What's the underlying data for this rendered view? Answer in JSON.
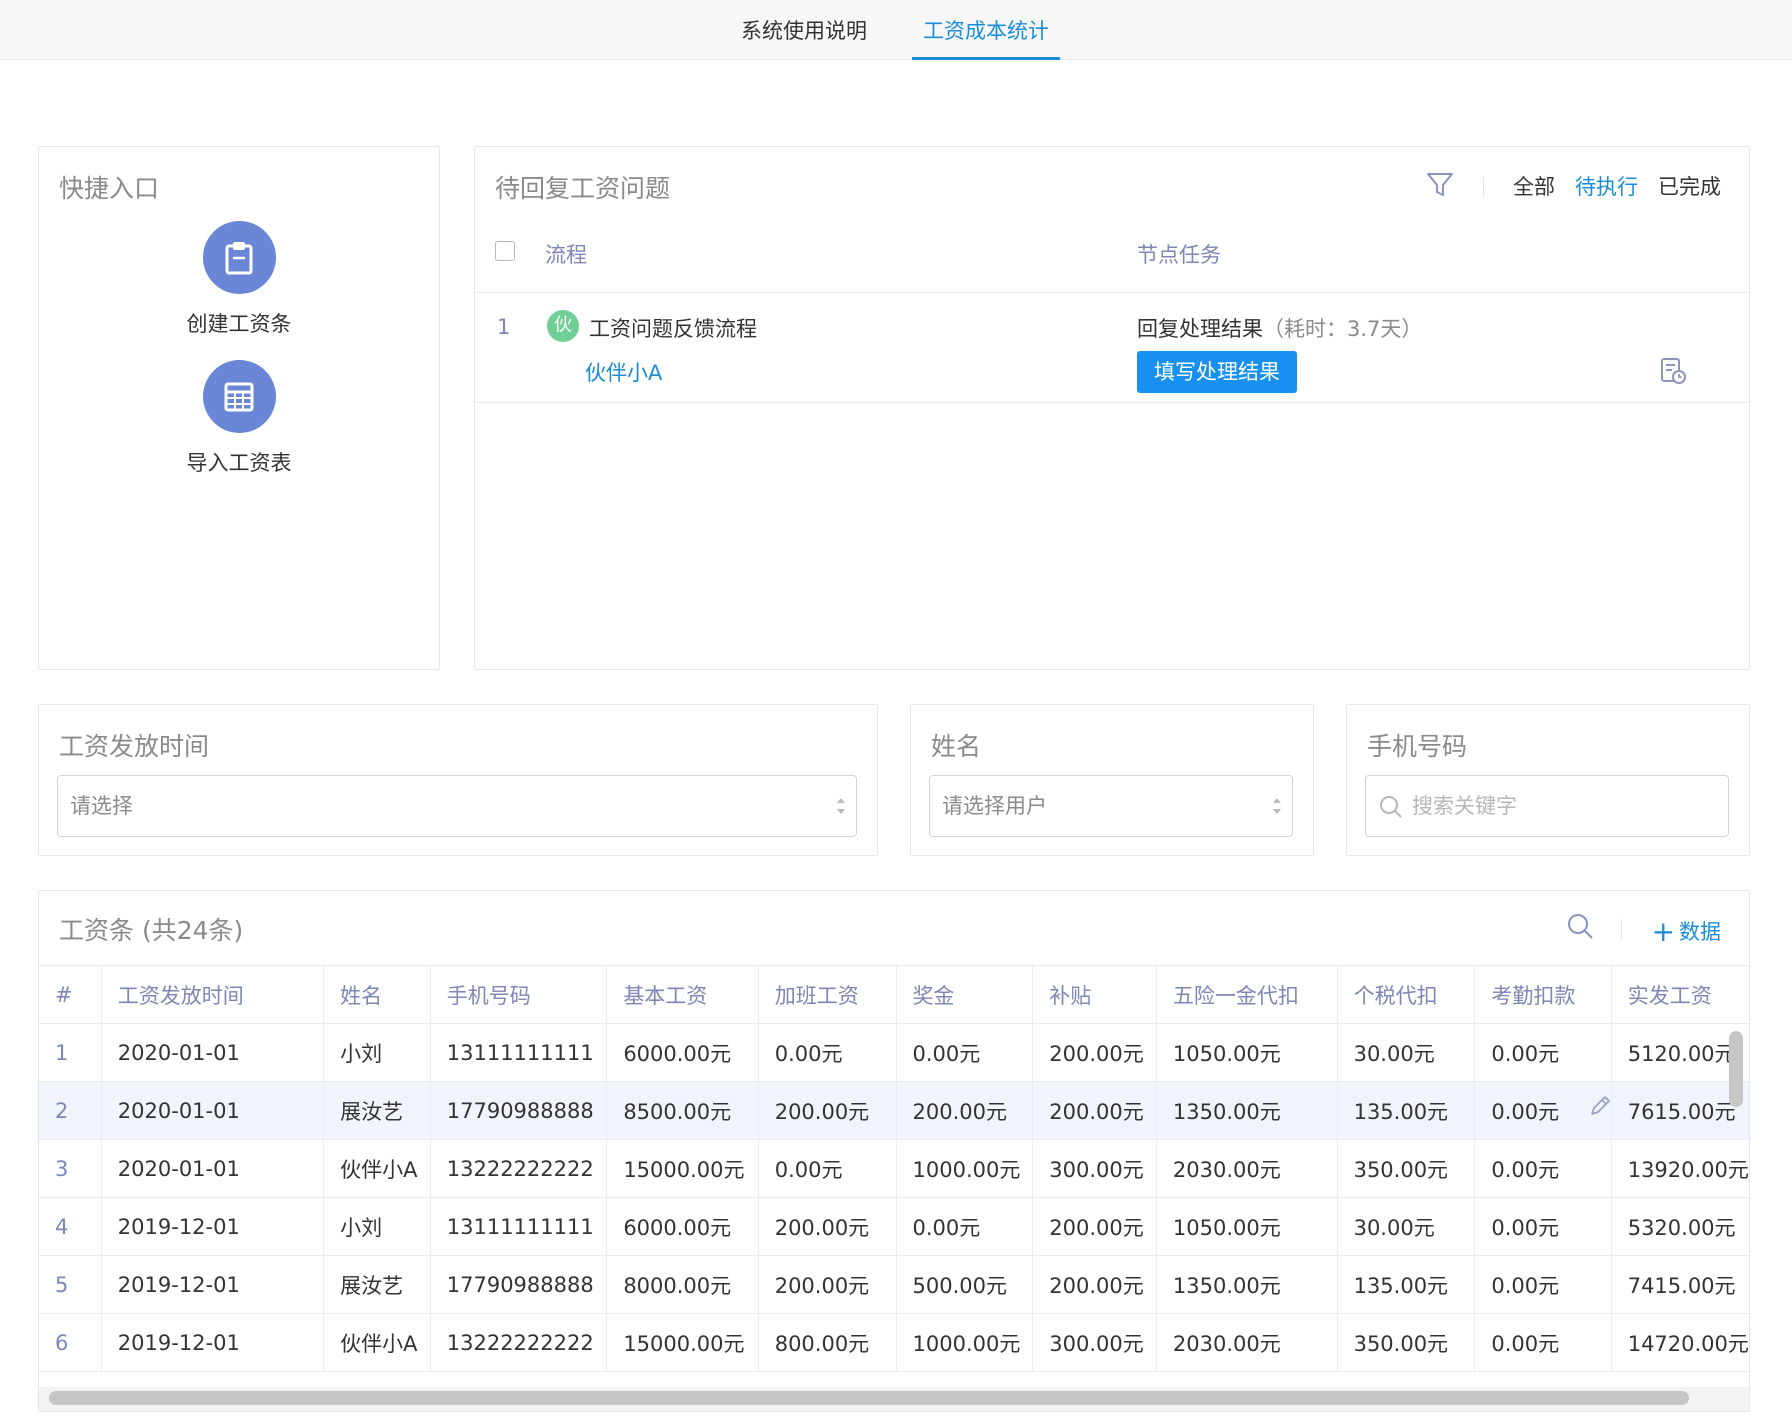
{
  "tabs": [
    {
      "label": "系统使用说明"
    },
    {
      "label": "工资成本统计"
    }
  ],
  "quick": {
    "title": "快捷入口",
    "items": [
      {
        "label": "创建工资条",
        "icon": "clipboard-icon"
      },
      {
        "label": "导入工资表",
        "icon": "table-icon"
      }
    ]
  },
  "pending": {
    "title": "待回复工资问题",
    "filter_tabs": [
      "全部",
      "待执行",
      "已完成"
    ],
    "active_tab": "待执行",
    "columns": [
      "流程",
      "节点任务"
    ],
    "rows": [
      {
        "index": "1",
        "avatar": "伙",
        "flow": "工资问题反馈流程",
        "user": "伙伴小A",
        "task": "回复处理结果",
        "duration": "（耗时：3.7天）",
        "action": "填写处理结果"
      }
    ]
  },
  "filters": {
    "date": {
      "label": "工资发放时间",
      "placeholder": "请选择"
    },
    "name": {
      "label": "姓名",
      "placeholder": "请选择用户"
    },
    "phone": {
      "label": "手机号码",
      "placeholder": "搜索关键字"
    }
  },
  "table": {
    "title": "工资条 (共24条)",
    "add_label": "数据",
    "headers": [
      "#",
      "工资发放时间",
      "姓名",
      "手机号码",
      "基本工资",
      "加班工资",
      "奖金",
      "补贴",
      "五险一金代扣",
      "个税代扣",
      "考勤扣款",
      "实发工资"
    ],
    "rows": [
      [
        "1",
        "2020-01-01",
        "小刘",
        "13111111111",
        "6000.00元",
        "0.00元",
        "0.00元",
        "200.00元",
        "1050.00元",
        "30.00元",
        "0.00元",
        "5120.00元"
      ],
      [
        "2",
        "2020-01-01",
        "展汝艺",
        "17790988888",
        "8500.00元",
        "200.00元",
        "200.00元",
        "200.00元",
        "1350.00元",
        "135.00元",
        "0.00元",
        "7615.00元"
      ],
      [
        "3",
        "2020-01-01",
        "伙伴小A",
        "13222222222",
        "15000.00元",
        "0.00元",
        "1000.00元",
        "300.00元",
        "2030.00元",
        "350.00元",
        "0.00元",
        "13920.00元"
      ],
      [
        "4",
        "2019-12-01",
        "小刘",
        "13111111111",
        "6000.00元",
        "200.00元",
        "0.00元",
        "200.00元",
        "1050.00元",
        "30.00元",
        "0.00元",
        "5320.00元"
      ],
      [
        "5",
        "2019-12-01",
        "展汝艺",
        "17790988888",
        "8000.00元",
        "200.00元",
        "500.00元",
        "200.00元",
        "1350.00元",
        "135.00元",
        "0.00元",
        "7415.00元"
      ],
      [
        "6",
        "2019-12-01",
        "伙伴小A",
        "13222222222",
        "15000.00元",
        "800.00元",
        "1000.00元",
        "300.00元",
        "2030.00元",
        "350.00元",
        "0.00元",
        "14720.00元"
      ]
    ],
    "highlight_row": 1
  }
}
